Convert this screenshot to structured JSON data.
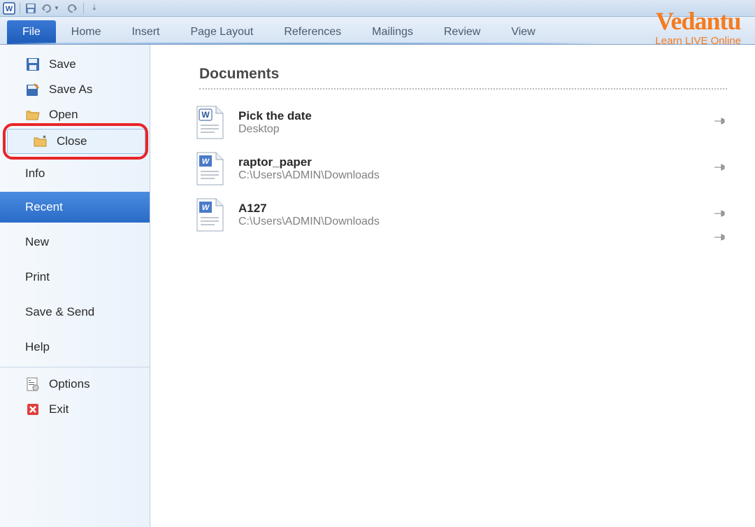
{
  "ribbon": {
    "tabs": [
      "File",
      "Home",
      "Insert",
      "Page Layout",
      "References",
      "Mailings",
      "Review",
      "View"
    ]
  },
  "sidebar": {
    "items": [
      {
        "label": "Save"
      },
      {
        "label": "Save As"
      },
      {
        "label": "Open"
      },
      {
        "label": "Close"
      },
      {
        "label": "Info"
      },
      {
        "label": "Recent"
      },
      {
        "label": "New"
      },
      {
        "label": "Print"
      },
      {
        "label": "Save & Send"
      },
      {
        "label": "Help"
      },
      {
        "label": "Options"
      },
      {
        "label": "Exit"
      }
    ]
  },
  "content": {
    "title": "Documents",
    "docs": [
      {
        "name": "Pick the date",
        "path": "Desktop"
      },
      {
        "name": "raptor_paper",
        "path": "C:\\Users\\ADMIN\\Downloads"
      },
      {
        "name": "A127",
        "path": "C:\\Users\\ADMIN\\Downloads"
      }
    ]
  },
  "brand": {
    "name": "Vedantu",
    "tagline": "Learn LIVE Online"
  }
}
